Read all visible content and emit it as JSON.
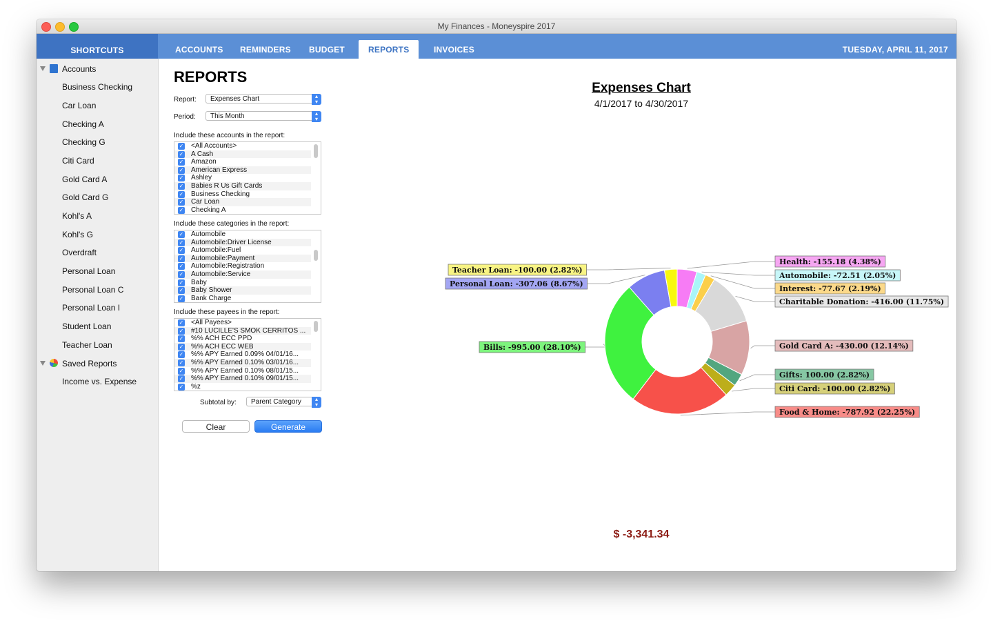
{
  "window": {
    "title": "My Finances - Moneyspire 2017"
  },
  "nav": {
    "shortcuts": "SHORTCUTS",
    "tabs": [
      {
        "label": "ACCOUNTS"
      },
      {
        "label": "REMINDERS"
      },
      {
        "label": "BUDGET"
      },
      {
        "label": "REPORTS"
      },
      {
        "label": "INVOICES"
      }
    ],
    "date": "TUESDAY, APRIL 11, 2017"
  },
  "sidebar": {
    "accounts_group": "Accounts",
    "accounts": [
      "Business Checking",
      "Car Loan",
      "Checking A",
      "Checking G",
      "Citi Card",
      "Gold Card A",
      "Gold Card G",
      "Kohl's A",
      "Kohl's G",
      "Overdraft",
      "Personal Loan",
      "Personal Loan C",
      "Personal Loan I",
      "Student Loan",
      "Teacher Loan"
    ],
    "reports_group": "Saved Reports",
    "reports": [
      "Income vs. Expense"
    ]
  },
  "form": {
    "heading": "REPORTS",
    "report_label": "Report:",
    "report_value": "Expenses Chart",
    "period_label": "Period:",
    "period_value": "This Month",
    "accounts_label": "Include these accounts in the report:",
    "accounts_list": [
      "<All Accounts>",
      "A Cash",
      "Amazon",
      "American Express",
      "Ashley",
      "Babies R Us Gift Cards",
      "Business Checking",
      "Car Loan",
      "Checking A"
    ],
    "categories_label": "Include these categories in the report:",
    "categories_list": [
      "Automobile",
      "Automobile:Driver License",
      "Automobile:Fuel",
      "Automobile:Payment",
      "Automobile:Registration",
      "Automobile:Service",
      "Baby",
      "Baby Shower",
      "Bank Charge"
    ],
    "payees_label": "Include these payees in the report:",
    "payees_list": [
      "<All Payees>",
      "#10 LUCILLE'S SMOK CERRITOS ...",
      "%% ACH ECC PPD",
      "%% ACH ECC WEB",
      "%% APY Earned 0.09% 04/01/16...",
      "%% APY Earned 0.10% 03/01/16...",
      "%% APY Earned 0.10% 08/01/15...",
      "%% APY Earned 0.10% 09/01/15...",
      "%z"
    ],
    "subtotal_label": "Subtotal by:",
    "subtotal_value": "Parent Category",
    "clear_label": "Clear",
    "generate_label": "Generate"
  },
  "chart": {
    "total": "$ -3,341.34"
  },
  "chart_data": {
    "type": "pie",
    "title": "Expenses Chart",
    "subtitle": "4/1/2017 to 4/30/2017",
    "slices": [
      {
        "label": "Health: -155.18 (4.38%)",
        "value": -155.18,
        "percent": 4.38,
        "color": "#f77cf5"
      },
      {
        "label": "Automobile: -72.51 (2.05%)",
        "value": -72.51,
        "percent": 2.05,
        "color": "#a9f5f8"
      },
      {
        "label": "Interest: -77.67 (2.19%)",
        "value": -77.67,
        "percent": 2.19,
        "color": "#fbcf4a"
      },
      {
        "label": "Charitable Donation: -416.00 (11.75%)",
        "value": -416.0,
        "percent": 11.75,
        "color": "#d9d9d9"
      },
      {
        "label": "Gold Card A: -430.00 (12.14%)",
        "value": -430.0,
        "percent": 12.14,
        "color": "#d8a4a4"
      },
      {
        "label": "Gifts: 100.00 (2.82%)",
        "value": 100.0,
        "percent": 2.82,
        "color": "#53a67f"
      },
      {
        "label": "Citi Card: -100.00 (2.82%)",
        "value": -100.0,
        "percent": 2.82,
        "color": "#bdae1a"
      },
      {
        "label": "Food & Home: -787.92 (22.25%)",
        "value": -787.92,
        "percent": 22.25,
        "color": "#f7514a"
      },
      {
        "label": "Bills: -995.00 (28.10%)",
        "value": -995.0,
        "percent": 28.1,
        "color": "#3ff23f"
      },
      {
        "label": "Personal Loan: -307.06 (8.67%)",
        "value": -307.06,
        "percent": 8.67,
        "color": "#7b7ff0"
      },
      {
        "label": "Teacher Loan: -100.00 (2.82%)",
        "value": -100.0,
        "percent": 2.82,
        "color": "#f8f80f"
      }
    ],
    "label_bg": {
      "Health": "#f6a6f2",
      "Automobile": "#c7f6f8",
      "Interest": "#fbd98a",
      "Charitable Donation": "#e8e8e8",
      "Gold Card A": "#e4bcbc",
      "Gifts": "#86c7a3",
      "Citi Card": "#d6d07a",
      "Food & Home": "#f88c88",
      "Bills": "#7df47d",
      "Personal Loan": "#a3a6f3",
      "Teacher Loan": "#f8f484"
    }
  }
}
